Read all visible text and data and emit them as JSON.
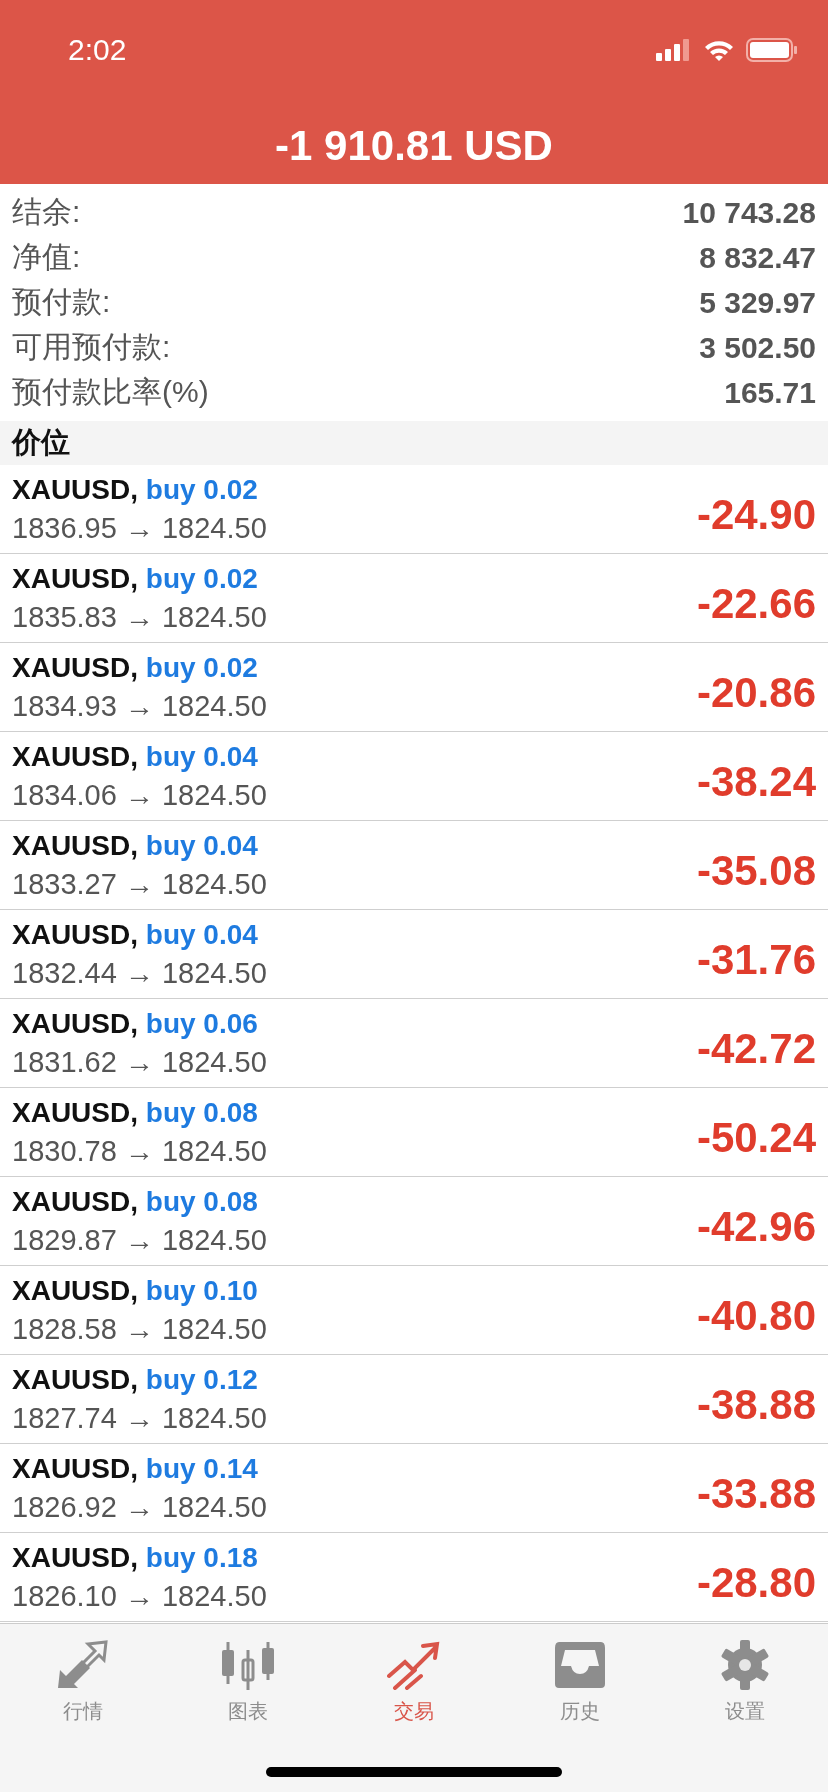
{
  "status_bar": {
    "time": "2:02"
  },
  "header": {
    "title": "-1 910.81 USD"
  },
  "summary": [
    {
      "label": "结余:",
      "value": "10 743.28"
    },
    {
      "label": "净值:",
      "value": "8 832.47"
    },
    {
      "label": "预付款:",
      "value": "5 329.97"
    },
    {
      "label": "可用预付款:",
      "value": "3 502.50"
    },
    {
      "label": "预付款比率(%)",
      "value": "165.71"
    }
  ],
  "section": {
    "title": "价位"
  },
  "positions": [
    {
      "symbol": "XAUUSD,",
      "order": "buy 0.02",
      "prices": "1836.95 → 1824.50",
      "profit": "-24.90"
    },
    {
      "symbol": "XAUUSD,",
      "order": "buy 0.02",
      "prices": "1835.83 → 1824.50",
      "profit": "-22.66"
    },
    {
      "symbol": "XAUUSD,",
      "order": "buy 0.02",
      "prices": "1834.93 → 1824.50",
      "profit": "-20.86"
    },
    {
      "symbol": "XAUUSD,",
      "order": "buy 0.04",
      "prices": "1834.06 → 1824.50",
      "profit": "-38.24"
    },
    {
      "symbol": "XAUUSD,",
      "order": "buy 0.04",
      "prices": "1833.27 → 1824.50",
      "profit": "-35.08"
    },
    {
      "symbol": "XAUUSD,",
      "order": "buy 0.04",
      "prices": "1832.44 → 1824.50",
      "profit": "-31.76"
    },
    {
      "symbol": "XAUUSD,",
      "order": "buy 0.06",
      "prices": "1831.62 → 1824.50",
      "profit": "-42.72"
    },
    {
      "symbol": "XAUUSD,",
      "order": "buy 0.08",
      "prices": "1830.78 → 1824.50",
      "profit": "-50.24"
    },
    {
      "symbol": "XAUUSD,",
      "order": "buy 0.08",
      "prices": "1829.87 → 1824.50",
      "profit": "-42.96"
    },
    {
      "symbol": "XAUUSD,",
      "order": "buy 0.10",
      "prices": "1828.58 → 1824.50",
      "profit": "-40.80"
    },
    {
      "symbol": "XAUUSD,",
      "order": "buy 0.12",
      "prices": "1827.74 → 1824.50",
      "profit": "-38.88"
    },
    {
      "symbol": "XAUUSD,",
      "order": "buy 0.14",
      "prices": "1826.92 → 1824.50",
      "profit": "-33.88"
    },
    {
      "symbol": "XAUUSD,",
      "order": "buy 0.18",
      "prices": "1826.10 → 1824.50",
      "profit": "-28.80"
    }
  ],
  "tabs": [
    {
      "kind": "quotes",
      "label": "行情",
      "selected": false
    },
    {
      "kind": "chart",
      "label": "图表",
      "selected": false
    },
    {
      "kind": "trade",
      "label": "交易",
      "selected": true
    },
    {
      "kind": "history",
      "label": "历史",
      "selected": false
    },
    {
      "kind": "settings",
      "label": "设置",
      "selected": false
    }
  ]
}
